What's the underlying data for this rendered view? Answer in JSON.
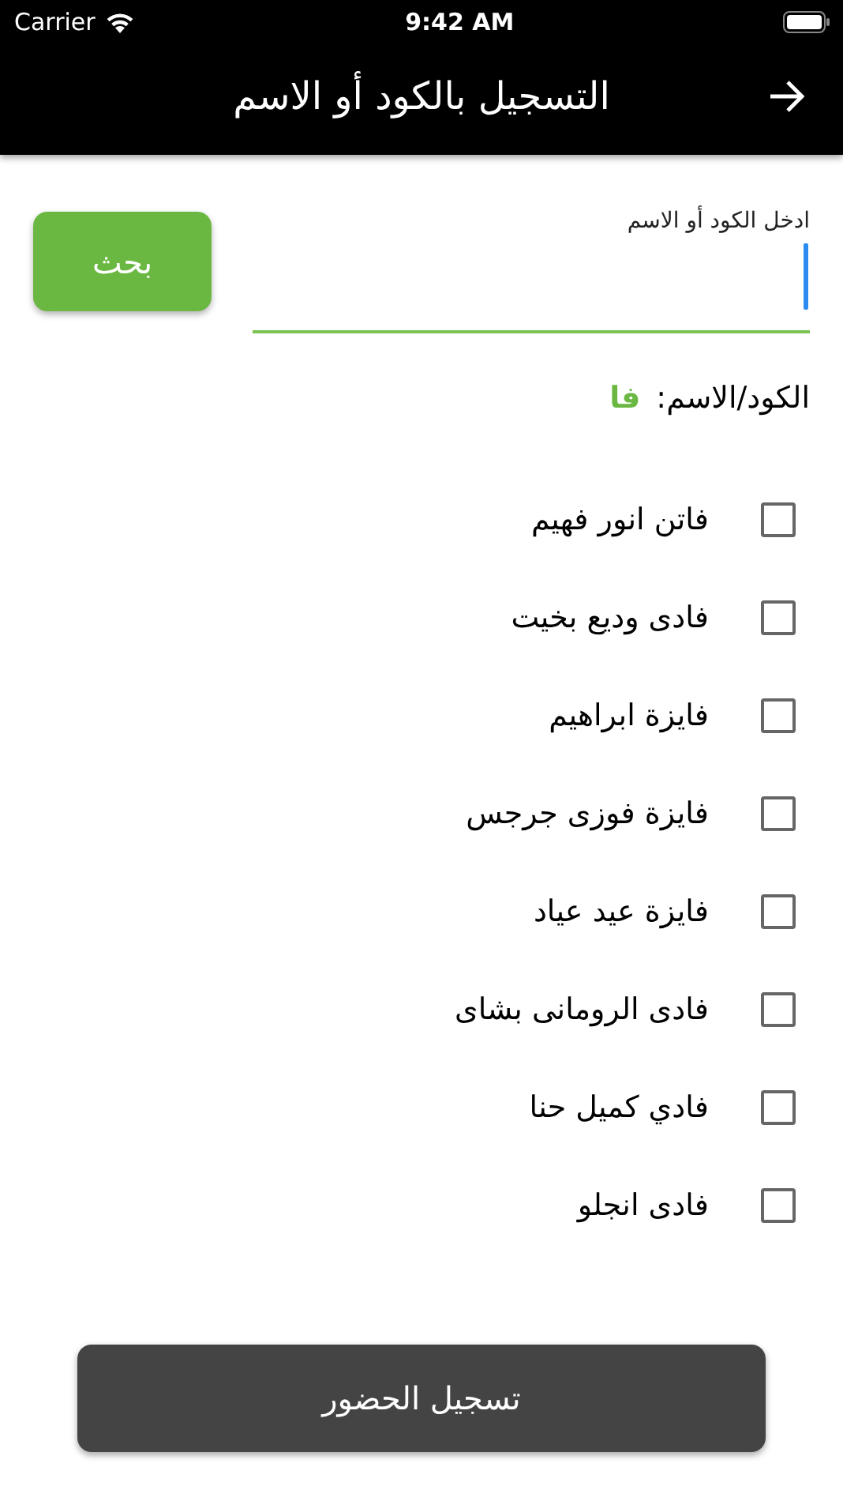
{
  "status_bar": {
    "carrier": "Carrier",
    "time": "9:42 AM"
  },
  "app_bar": {
    "title": "التسجيل بالكود أو الاسم"
  },
  "search": {
    "label": "ادخل الكود أو الاسم",
    "button": "بحث"
  },
  "result": {
    "label": "الكود/الاسم:",
    "query": "فا"
  },
  "people": [
    {
      "name": "فاتن انور فهيم",
      "checked": false
    },
    {
      "name": "فادى وديع بخيت",
      "checked": false
    },
    {
      "name": "فايزة ابراهيم",
      "checked": false
    },
    {
      "name": "فايزة فوزى جرجس",
      "checked": false
    },
    {
      "name": "فايزة عيد عياد",
      "checked": false
    },
    {
      "name": "فادى الرومانى بشاى",
      "checked": false
    },
    {
      "name": "فادي كميل حنا",
      "checked": false
    },
    {
      "name": "فادى انجلو",
      "checked": false
    }
  ],
  "submit_button": "تسجيل الحضور"
}
